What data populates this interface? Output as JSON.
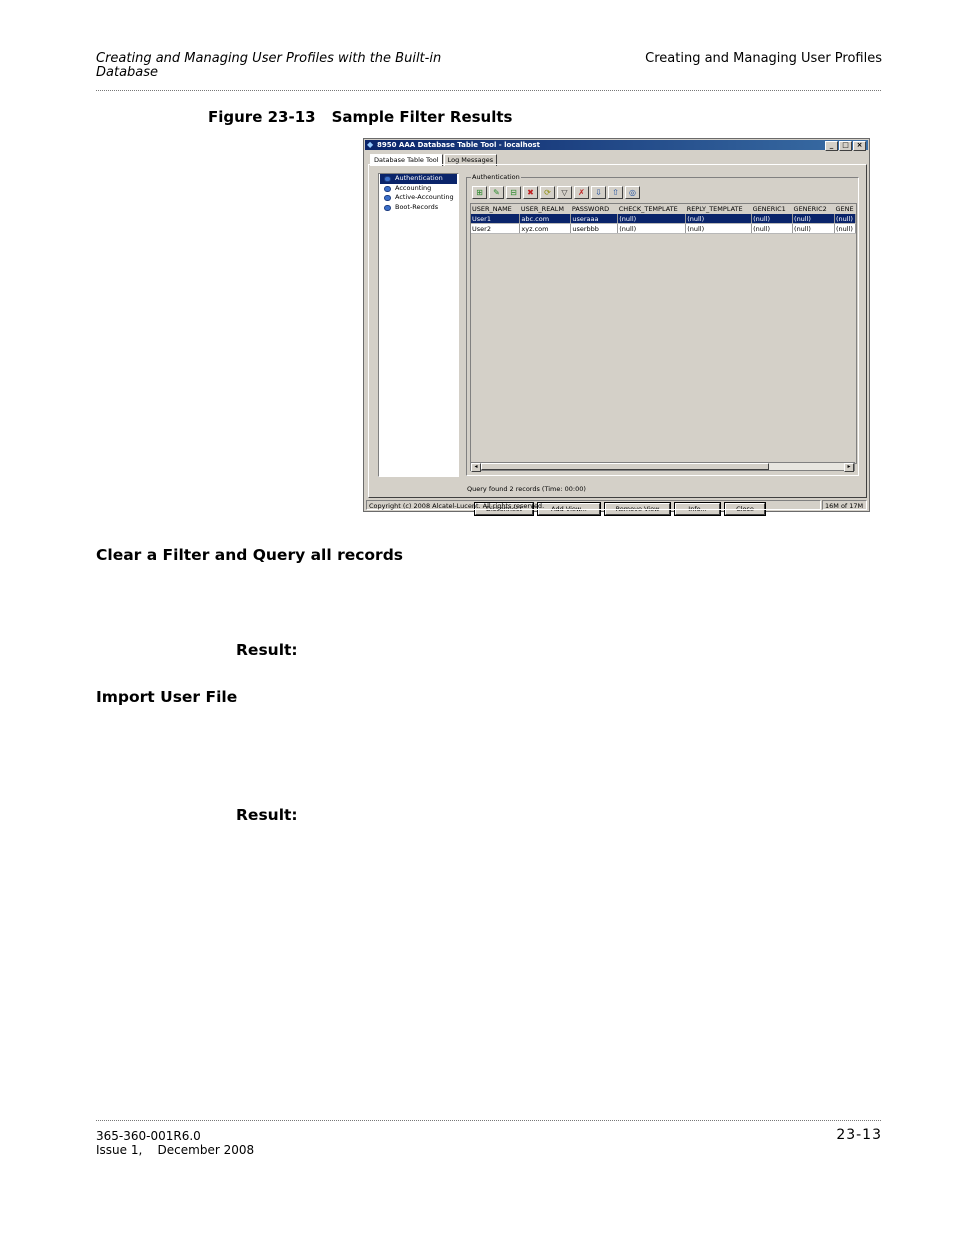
{
  "header": {
    "left": "Creating and Managing User Profiles with the Built-in Database",
    "right": "Creating and Managing User Profiles"
  },
  "figure": {
    "number": "Figure 23-13",
    "title": "Sample Filter Results"
  },
  "app": {
    "title": "8950 AAA Database Table Tool - localhost",
    "window_buttons": [
      "_",
      "□",
      "×"
    ],
    "tabs": [
      "Database Table Tool",
      "Log Messages"
    ],
    "tree_items": [
      "Authentication",
      "Accounting",
      "Active-Accounting",
      "Boot-Records"
    ],
    "group_label": "Authentication",
    "toolbar_icons": [
      "add-row-icon",
      "edit-row-icon",
      "copy-row-icon",
      "delete-row-icon",
      "refresh-icon",
      "filter-icon",
      "clear-filter-icon",
      "import-icon",
      "export-icon",
      "database-icon"
    ],
    "table": {
      "columns": [
        "USER_NAME",
        "USER_REALM",
        "PASSWORD",
        "CHECK_TEMPLATE",
        "REPLY_TEMPLATE",
        "GENERIC1",
        "GENERIC2",
        "GENE"
      ],
      "rows": [
        [
          "User1",
          "abc.com",
          "useraaa",
          "(null)",
          "(null)",
          "(null)",
          "(null)",
          "(null)"
        ],
        [
          "User2",
          "xyz.com",
          "userbbb",
          "(null)",
          "(null)",
          "(null)",
          "(null)",
          "(null)"
        ]
      ]
    },
    "status_text": "Query found 2 records (Time: 00:00)",
    "buttons": [
      "Disconnect",
      "Add View...",
      "Remove View",
      "Info...",
      "Close"
    ],
    "statusbar_left": "Copyright (c) 2008 Alcatel-Lucent. All rights reserved.",
    "statusbar_right": "16M of 17M"
  },
  "sections": [
    {
      "heading": "Clear a Filter and Query all records",
      "result_label": "Result:"
    },
    {
      "heading": "Import User File",
      "result_label": "Result:"
    }
  ],
  "footer": {
    "doc_number": "365-360-001R6.0",
    "issue": "Issue 1,    December 2008",
    "page": "23-13"
  }
}
